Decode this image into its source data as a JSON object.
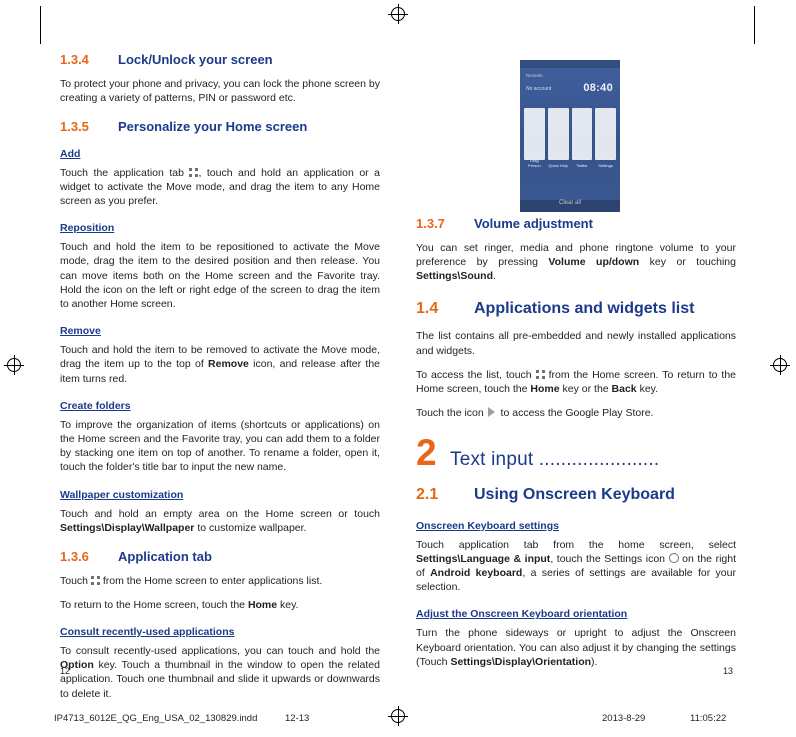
{
  "document": {
    "left_page_number": "12",
    "right_page_number": "13",
    "footer": {
      "filename": "IP4713_6012E_QG_Eng_USA_02_130829.indd",
      "pages": "12-13",
      "date": "2013-8-29",
      "time": "11:05:22"
    }
  },
  "left_column": {
    "s134": {
      "num": "1.3.4",
      "title": "Lock/Unlock your screen",
      "body": "To protect your phone and privacy, you can lock the phone screen by creating a variety of patterns, PIN or password etc."
    },
    "s135": {
      "num": "1.3.5",
      "title": "Personalize your Home screen",
      "add_heading": "Add",
      "add_body_1": "Touch the application tab ",
      "add_body_2": ", touch and hold an application or a widget to activate the Move mode, and drag the item to any Home screen as you prefer.",
      "reposition_heading": "Reposition",
      "reposition_body": "Touch and hold the item to be repositioned to activate the Move mode, drag the item to the desired position and then release. You can move items both on the Home screen and the Favorite tray. Hold the icon on the left or right edge of the screen to drag the item to another Home screen.",
      "remove_heading": "Remove",
      "remove_body_1": "Touch and hold the item to be removed to activate the Move mode, drag the item up to the top of ",
      "remove_bold": "Remove",
      "remove_body_2": " icon, and release after the item turns red.",
      "folders_heading": "Create folders",
      "folders_body": "To improve the organization of items (shortcuts or applications) on the Home screen and the Favorite tray, you can add them to a folder by stacking one item on top of another. To rename a folder, open it, touch the folder's title bar to input the new name.",
      "wallpaper_heading": "Wallpaper customization",
      "wallpaper_body_1": "Touch and hold an empty area on the Home screen or touch ",
      "wallpaper_bold": "Settings\\Display\\Wallpaper",
      "wallpaper_body_2": " to customize wallpaper."
    },
    "s136": {
      "num": "1.3.6",
      "title": "Application tab",
      "body_1": "Touch ",
      "body_2": " from the Home screen to enter applications list.",
      "body2_1": "To return to the Home screen, touch the ",
      "body2_bold": "Home",
      "body2_2": " key.",
      "consult_heading": "Consult recently-used applications",
      "consult_1": "To consult recently-used applications, you can touch and hold the ",
      "consult_bold": "Option",
      "consult_2": " key. Touch a thumbnail in the window to open the related application. Touch one thumbnail and slide it upwards or downwards to delete it."
    }
  },
  "right_column": {
    "phone_screenshot": {
      "status_label": "Recents",
      "clock": "08:40",
      "subtitle": "No account",
      "clear_all": "Clear all",
      "cards": [
        "Drag Person",
        "Quick Help",
        "Twitter",
        "Settings"
      ]
    },
    "s137": {
      "num": "1.3.7",
      "title": "Volume adjustment",
      "body_1": "You can set ringer, media and phone ringtone volume to your preference by pressing ",
      "bold_1": "Volume up/down",
      "body_2": " key or touching ",
      "bold_2": "Settings\\Sound",
      "body_3": "."
    },
    "s14": {
      "num": "1.4",
      "title": "Applications and widgets list",
      "body_1": "The list contains all pre-embedded and newly installed applications and widgets.",
      "body_2a": "To access the list, touch ",
      "body_2b": " from the Home screen. To return to the Home screen, touch the ",
      "bold_home": "Home",
      "body_2c": " key or the ",
      "bold_back": "Back",
      "body_2d": " key.",
      "body_3a": "Touch the icon ",
      "body_3b": " to access the Google Play Store."
    },
    "chapter": {
      "number": "2",
      "title": "Text input ......................"
    },
    "s21": {
      "num": "2.1",
      "title": "Using Onscreen Keyboard",
      "settings_heading": "Onscreen Keyboard settings",
      "settings_1": "Touch application tab from the home screen, select ",
      "settings_bold1": "Settings\\Language & input",
      "settings_2": ", touch the Settings icon ",
      "settings_3": " on the right of ",
      "settings_bold2": "Android keyboard",
      "settings_4": ", a series of settings are available for your selection.",
      "orientation_heading": "Adjust the Onscreen Keyboard orientation",
      "orientation_1": "Turn the phone sideways or upright to adjust the Onscreen Keyboard orientation. You can also adjust it by changing the settings (Touch ",
      "orientation_bold": "Settings\\Display\\Orientation",
      "orientation_2": ")."
    }
  },
  "colors": {
    "heading_blue": "#1b3a8a",
    "accent_orange": "#e8661a",
    "body_text": "#231f20"
  }
}
